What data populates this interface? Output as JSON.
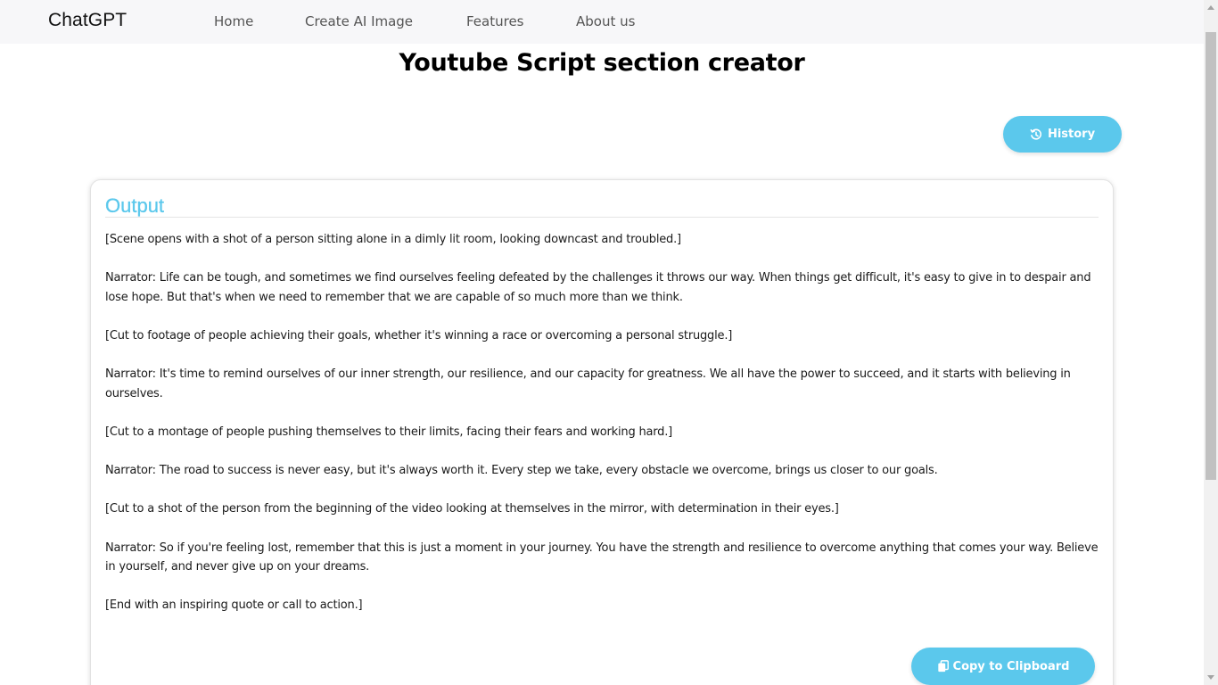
{
  "navbar": {
    "brand": "ChatGPT",
    "links": [
      "Home",
      "Create AI Image",
      "Features",
      "About us"
    ]
  },
  "page": {
    "title": "Youtube Script section creator"
  },
  "history_button": {
    "label": "History",
    "icon": "history-icon"
  },
  "output": {
    "title": "Output",
    "paragraphs": [
      "[Scene opens with a shot of a person sitting alone in a dimly lit room, looking downcast and troubled.]",
      "Narrator: Life can be tough, and sometimes we find ourselves feeling defeated by the challenges it throws our way. When things get difficult, it's easy to give in to despair and lose hope. But that's when we need to remember that we are capable of so much more than we think.",
      "[Cut to footage of people achieving their goals, whether it's winning a race or overcoming a personal struggle.]",
      "Narrator: It's time to remind ourselves of our inner strength, our resilience, and our capacity for greatness. We all have the power to succeed, and it starts with believing in ourselves.",
      "[Cut to a montage of people pushing themselves to their limits, facing their fears and working hard.]",
      "Narrator: The road to success is never easy, but it's always worth it. Every step we take, every obstacle we overcome, brings us closer to our goals.",
      "[Cut to a shot of the person from the beginning of the video looking at themselves in the mirror, with determination in their eyes.]",
      "Narrator: So if you're feeling lost, remember that this is just a moment in your journey. You have the strength and resilience to overcome anything that comes your way. Believe in yourself, and never give up on your dreams.",
      "[End with an inspiring quote or call to action.]"
    ]
  },
  "copy_button": {
    "label": "Copy to Clipboard",
    "icon": "copy-icon"
  },
  "colors": {
    "accent": "#5bc8ec",
    "navbar_bg": "#f7f7f9",
    "text": "#1a1a1a"
  }
}
